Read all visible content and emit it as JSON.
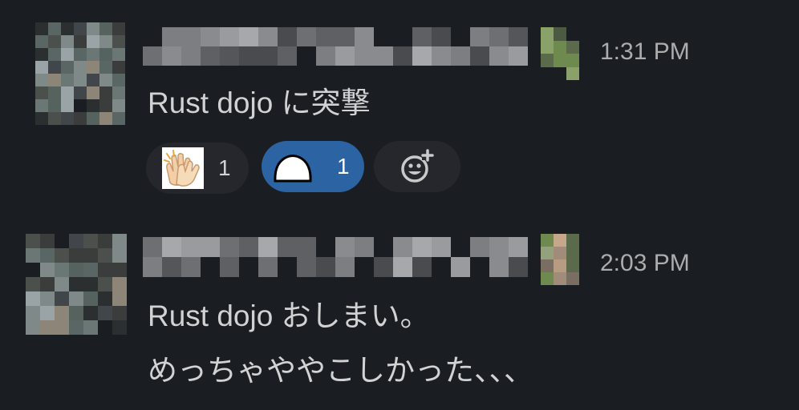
{
  "messages": [
    {
      "timestamp": "1:31 PM",
      "lines": [
        "Rust dojo に突撃"
      ],
      "reactions": [
        {
          "emoji": "clapping-hands",
          "count": "1",
          "selected": false
        },
        {
          "emoji": "mochi",
          "count": "1",
          "selected": true
        }
      ],
      "add_reaction_icon": "add-reaction-icon"
    },
    {
      "timestamp": "2:03 PM",
      "lines": [
        "Rust dojo おしまい。",
        "めっちゃややこしかった、、、"
      ]
    }
  ],
  "colors": {
    "background": "#1a1d21",
    "text": "#d1d2d3",
    "timestamp": "#abacae",
    "reaction_bg": "#25272c",
    "reaction_selected_bg": "#2b63a3"
  }
}
